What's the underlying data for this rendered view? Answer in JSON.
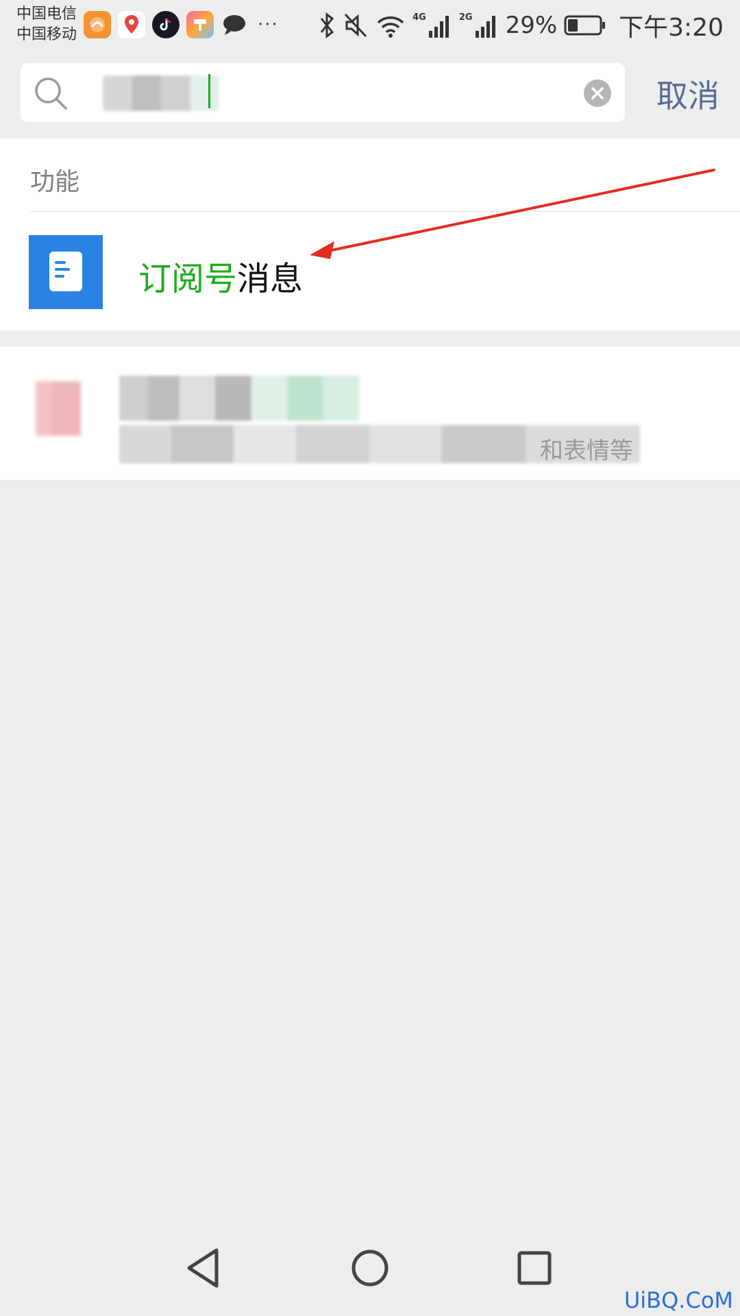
{
  "status_bar": {
    "carrier_1": "中国电信",
    "carrier_2": "中国移动",
    "more": "···",
    "net_4g": "4G",
    "net_2g": "2G",
    "battery": "29%",
    "time": "下午3:20",
    "icons": [
      "uc-browser-icon",
      "map-pin-icon",
      "tiktok-icon",
      "paint-app-icon",
      "chat-bubble-icon",
      "bluetooth-icon",
      "mute-icon",
      "wifi-icon",
      "signal-icon",
      "battery-icon"
    ]
  },
  "search": {
    "query": "",
    "cancel_label": "取消"
  },
  "functions": {
    "title": "功能",
    "result": {
      "highlight": "订阅号",
      "rest": "消息",
      "icon": "article-document-icon",
      "icon_color": "#2a82e4"
    }
  },
  "result2": {
    "tail_text": "和表情等"
  },
  "watermark": "UiBQ.CoM",
  "colors": {
    "accent_green": "#1aad19",
    "link_blue": "#576b95",
    "background": "#ededed",
    "annotation_red": "#e52a22"
  }
}
